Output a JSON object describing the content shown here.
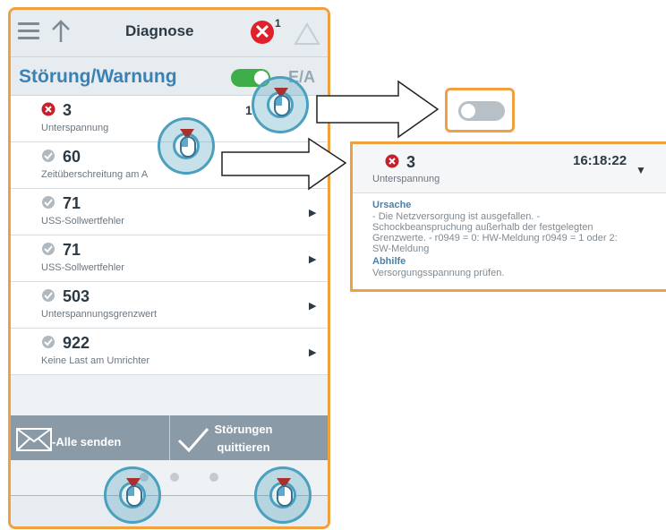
{
  "header": {
    "title": "Diagnose",
    "error_badge": "✕",
    "error_count": "1"
  },
  "subheader": {
    "title": "Störung/Warnung",
    "toggle_state": "on",
    "right_label": "E/A"
  },
  "list": [
    {
      "number": "3",
      "description": "Unterspannung",
      "type": "error",
      "time": "1"
    },
    {
      "number": "60",
      "description": "Zeitüberschreitung am A",
      "type": "warning"
    },
    {
      "number": "71",
      "description": "USS-Sollwertfehler",
      "type": "warning"
    },
    {
      "number": "71",
      "description": "USS-Sollwertfehler",
      "type": "warning"
    },
    {
      "number": "503",
      "description": "Unterspannungsgrenzwert",
      "type": "warning"
    },
    {
      "number": "922",
      "description": "Keine Last am Umrichter",
      "type": "warning"
    }
  ],
  "actions": {
    "send_all": "-Alle senden",
    "ack_line1": "Störungen",
    "ack_line2": "quittieren"
  },
  "toggle_callout": {
    "state": "off"
  },
  "detail": {
    "number": "3",
    "description": "Unterspannung",
    "time": "16:18:22",
    "cause_label": "Ursache",
    "cause_line1": "- Die Netzversorgung ist ausgefallen. -",
    "cause_line2": "Schockbeanspruchung außerhalb der festgelegten",
    "cause_line3": "Grenzwerte. - r0949 = 0: HW-Meldung r0949 = 1 oder 2:",
    "cause_line4": "SW-Meldung",
    "remedy_label": "Abhilfe",
    "remedy_text": "Versorgungsspannung prüfen."
  },
  "colors": {
    "accent": "#f0a040",
    "title_blue": "#3a82b5",
    "error_red": "#e0202a",
    "toggle_green": "#3fae49"
  }
}
